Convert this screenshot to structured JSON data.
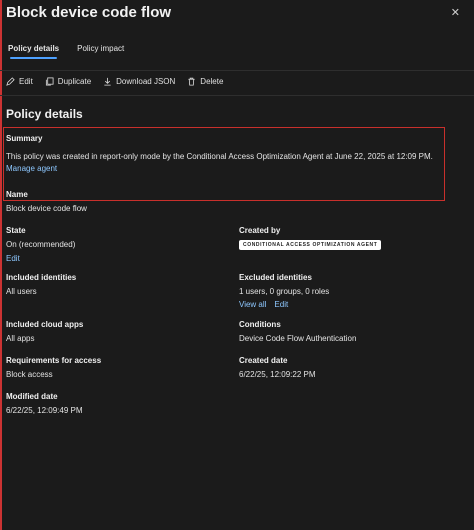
{
  "header": {
    "title": "Block device code flow",
    "close_label": "✕"
  },
  "tabs": [
    {
      "label": "Policy details",
      "active": true
    },
    {
      "label": "Policy impact",
      "active": false
    }
  ],
  "toolbar": {
    "edit_label": "Edit",
    "duplicate_label": "Duplicate",
    "download_label": "Download JSON",
    "delete_label": "Delete"
  },
  "section_title": "Policy details",
  "summary": {
    "label": "Summary",
    "text": "This policy was created in report-only mode by the Conditional Access Optimization Agent at June 22, 2025 at 12:09 PM.",
    "link": "Manage agent"
  },
  "name": {
    "label": "Name",
    "value": "Block device code flow"
  },
  "state": {
    "label": "State",
    "value": "On (recommended)",
    "link": "Edit"
  },
  "created_by": {
    "label": "Created by",
    "badge": "Conditional Access Optimization Agent"
  },
  "included_identities": {
    "label": "Included identities",
    "value": "All users"
  },
  "excluded_identities": {
    "label": "Excluded identities",
    "value": "1 users, 0 groups, 0 roles",
    "view_all": "View all",
    "edit": "Edit"
  },
  "included_cloud_apps": {
    "label": "Included cloud apps",
    "value": "All apps"
  },
  "conditions": {
    "label": "Conditions",
    "value": "Device Code Flow Authentication"
  },
  "requirements": {
    "label": "Requirements for access",
    "value": "Block access"
  },
  "created_date": {
    "label": "Created date",
    "value": "6/22/25, 12:09:22 PM"
  },
  "modified_date": {
    "label": "Modified date",
    "value": "6/22/25, 12:09:49 PM"
  },
  "colors": {
    "background": "#1b1b1b",
    "link": "#8ec8ff",
    "tab_underline": "#4ea1ff",
    "highlight_border": "#c9302c"
  }
}
